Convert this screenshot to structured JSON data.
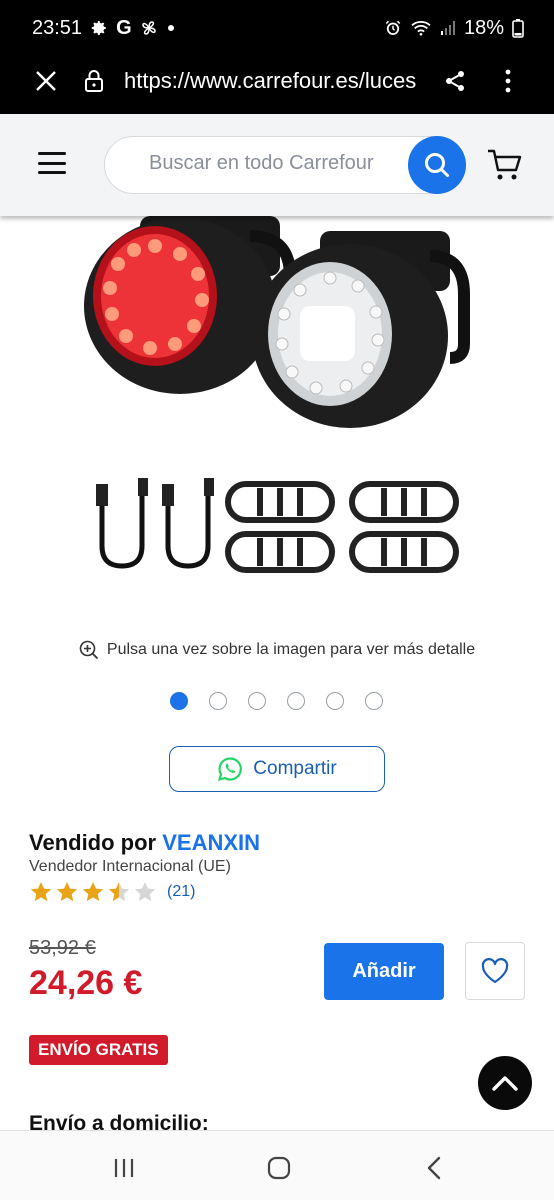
{
  "status_bar": {
    "time": "23:51",
    "google_letter": "G",
    "battery": "18%"
  },
  "browser": {
    "url": "https://www.carrefour.es/luces"
  },
  "header": {
    "search_placeholder": "Buscar en todo Carrefour"
  },
  "gallery": {
    "zoom_hint": "Pulsa una vez sobre la imagen para ver más detalle",
    "page_count": 6,
    "active_index": 0
  },
  "share": {
    "label": "Compartir"
  },
  "seller": {
    "prefix": "Vendido por",
    "name": "VEANXIN",
    "type": "Vendedor Internacional (UE)",
    "rating": 3.5,
    "rating_max": 5,
    "rating_count": "(21)"
  },
  "pricing": {
    "old_price": "53,92 €",
    "price": "24,26 €",
    "add_label": "Añadir",
    "free_shipping": "ENVÍO GRATIS"
  },
  "delivery": {
    "heading": "Envío a domicilio:"
  },
  "colors": {
    "accent_blue": "#1a73e8",
    "price_red": "#d11a2a",
    "star_gold": "#e8a317",
    "whatsapp_green": "#25d366"
  }
}
